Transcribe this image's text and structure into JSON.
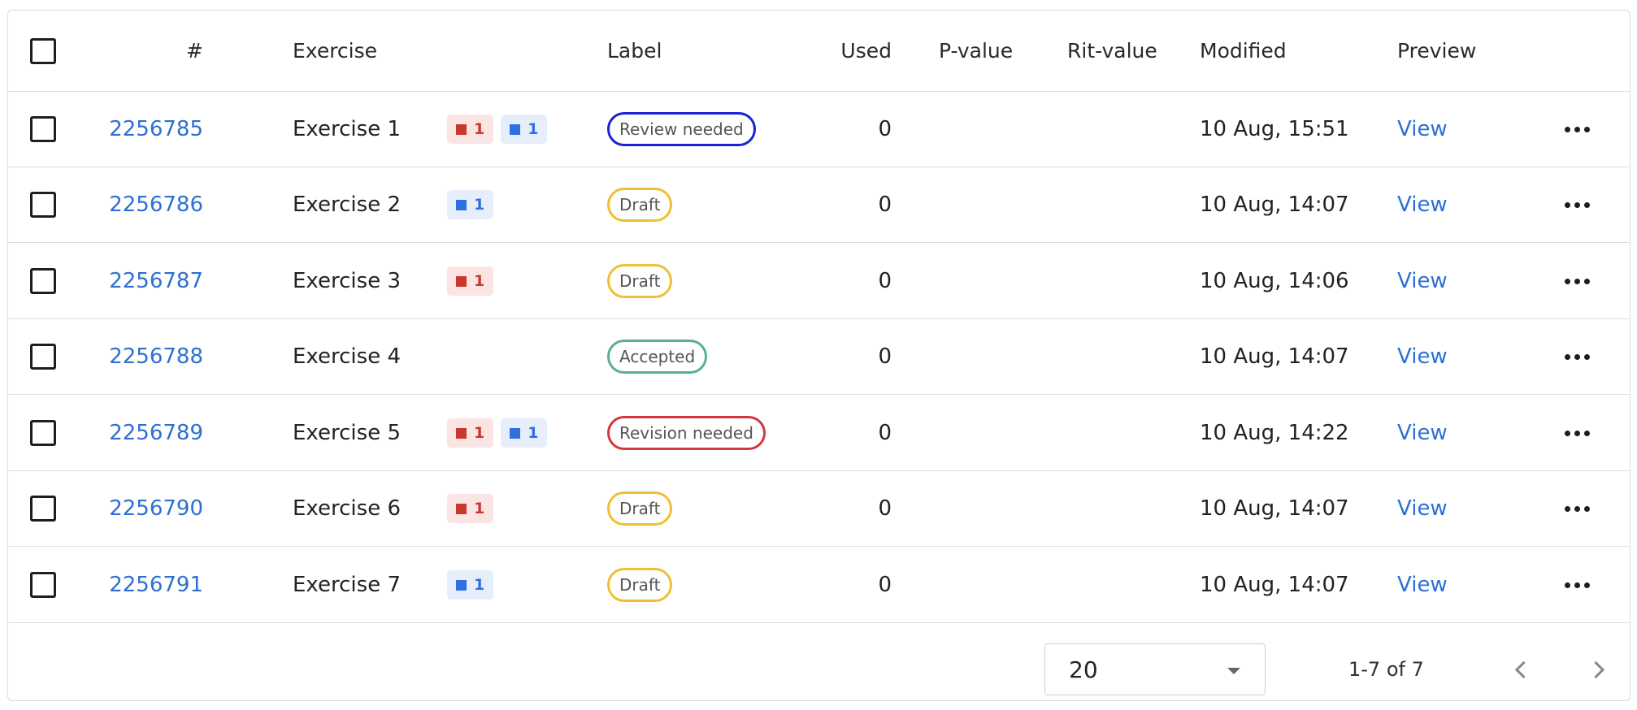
{
  "columns": {
    "id": "#",
    "exercise": "Exercise",
    "label": "Label",
    "used": "Used",
    "p_value": "P-value",
    "rit_value": "Rit-value",
    "modified": "Modified",
    "preview": "Preview"
  },
  "status_colors": {
    "Review needed": "#1a22d6",
    "Draft": "#f0c030",
    "Accepted": "#5aae98",
    "Revision needed": "#d03a3e"
  },
  "tag_colors": {
    "red": "#c8382f",
    "blue": "#2f6fe0"
  },
  "rows": [
    {
      "id": "2256785",
      "exercise": "Exercise 1",
      "tags": [
        {
          "color": "red",
          "count": "1"
        },
        {
          "color": "blue",
          "count": "1"
        }
      ],
      "label": "Review needed",
      "used": "0",
      "p_value": "",
      "rit_value": "",
      "modified": "10 Aug, 15:51",
      "preview": "View"
    },
    {
      "id": "2256786",
      "exercise": "Exercise 2",
      "tags": [
        {
          "color": "blue",
          "count": "1"
        }
      ],
      "label": "Draft",
      "used": "0",
      "p_value": "",
      "rit_value": "",
      "modified": "10 Aug, 14:07",
      "preview": "View"
    },
    {
      "id": "2256787",
      "exercise": "Exercise 3",
      "tags": [
        {
          "color": "red",
          "count": "1"
        }
      ],
      "label": "Draft",
      "used": "0",
      "p_value": "",
      "rit_value": "",
      "modified": "10 Aug, 14:06",
      "preview": "View"
    },
    {
      "id": "2256788",
      "exercise": "Exercise 4",
      "tags": [],
      "label": "Accepted",
      "used": "0",
      "p_value": "",
      "rit_value": "",
      "modified": "10 Aug, 14:07",
      "preview": "View"
    },
    {
      "id": "2256789",
      "exercise": "Exercise 5",
      "tags": [
        {
          "color": "red",
          "count": "1"
        },
        {
          "color": "blue",
          "count": "1"
        }
      ],
      "label": "Revision needed",
      "used": "0",
      "p_value": "",
      "rit_value": "",
      "modified": "10 Aug, 14:22",
      "preview": "View"
    },
    {
      "id": "2256790",
      "exercise": "Exercise 6",
      "tags": [
        {
          "color": "red",
          "count": "1"
        }
      ],
      "label": "Draft",
      "used": "0",
      "p_value": "",
      "rit_value": "",
      "modified": "10 Aug, 14:07",
      "preview": "View"
    },
    {
      "id": "2256791",
      "exercise": "Exercise 7",
      "tags": [
        {
          "color": "blue",
          "count": "1"
        }
      ],
      "label": "Draft",
      "used": "0",
      "p_value": "",
      "rit_value": "",
      "modified": "10 Aug, 14:07",
      "preview": "View"
    }
  ],
  "pagination": {
    "rows_per_page": "20",
    "range": "1-7 of 7"
  },
  "icons": {
    "row_menu": "more-horizontal-icon",
    "select_caret": "caret-down-icon",
    "prev": "chevron-left-icon",
    "next": "chevron-right-icon"
  }
}
